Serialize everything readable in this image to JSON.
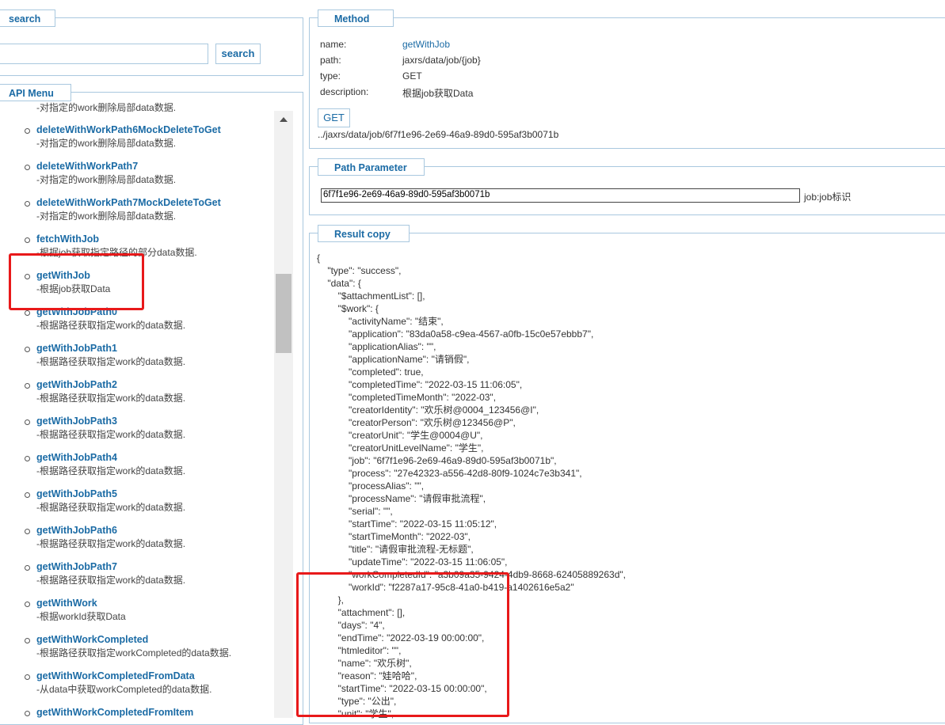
{
  "search": {
    "legend": "search",
    "input_value": "",
    "button_label": "search"
  },
  "menu": {
    "legend": "API Menu",
    "partial_top_text": "-对指定的work删除局部data数据.",
    "items": [
      {
        "name": "deleteWithWorkPath6MockDeleteToGet",
        "desc": "-对指定的work删除局部data数据."
      },
      {
        "name": "deleteWithWorkPath7",
        "desc": "-对指定的work删除局部data数据."
      },
      {
        "name": "deleteWithWorkPath7MockDeleteToGet",
        "desc": "-对指定的work删除局部data数据."
      },
      {
        "name": "fetchWithJob",
        "desc": "-根据job获取指定路径的部分data数据."
      },
      {
        "name": "getWithJob",
        "desc": "-根据job获取Data"
      },
      {
        "name": "getWithJobPath0",
        "desc": "-根据路径获取指定work的data数据."
      },
      {
        "name": "getWithJobPath1",
        "desc": "-根据路径获取指定work的data数据."
      },
      {
        "name": "getWithJobPath2",
        "desc": "-根据路径获取指定work的data数据."
      },
      {
        "name": "getWithJobPath3",
        "desc": "-根据路径获取指定work的data数据."
      },
      {
        "name": "getWithJobPath4",
        "desc": "-根据路径获取指定work的data数据."
      },
      {
        "name": "getWithJobPath5",
        "desc": "-根据路径获取指定work的data数据."
      },
      {
        "name": "getWithJobPath6",
        "desc": "-根据路径获取指定work的data数据."
      },
      {
        "name": "getWithJobPath7",
        "desc": "-根据路径获取指定work的data数据."
      },
      {
        "name": "getWithWork",
        "desc": "-根据workId获取Data"
      },
      {
        "name": "getWithWorkCompleted",
        "desc": "-根据路径获取指定workCompleted的data数据."
      },
      {
        "name": "getWithWorkCompletedFromData",
        "desc": "-从data中获取workCompleted的data数据."
      },
      {
        "name": "getWithWorkCompletedFromItem",
        "desc": ""
      }
    ]
  },
  "method": {
    "legend": "Method",
    "name_label": "name:",
    "name_value": "getWithJob",
    "path_label": "path:",
    "path_value": "jaxrs/data/job/{job}",
    "type_label": "type:",
    "type_value": "GET",
    "description_label": "description:",
    "description_value": "根据job获取Data",
    "get_button": "GET",
    "request_url": "../jaxrs/data/job/6f7f1e96-2e69-46a9-89d0-595af3b0071b"
  },
  "path_parameter": {
    "legend": "Path Parameter",
    "job_value": "6f7f1e96-2e69-46a9-89d0-595af3b0071b",
    "job_label": "job:job标识"
  },
  "result": {
    "legend": "Result copy",
    "json_text": "{\n    \"type\": \"success\",\n    \"data\": {\n        \"$attachmentList\": [],\n        \"$work\": {\n            \"activityName\": \"结束\",\n            \"application\": \"83da0a58-c9ea-4567-a0fb-15c0e57ebbb7\",\n            \"applicationAlias\": \"\",\n            \"applicationName\": \"请销假\",\n            \"completed\": true,\n            \"completedTime\": \"2022-03-15 11:06:05\",\n            \"completedTimeMonth\": \"2022-03\",\n            \"creatorIdentity\": \"欢乐树@0004_123456@I\",\n            \"creatorPerson\": \"欢乐树@123456@P\",\n            \"creatorUnit\": \"学生@0004@U\",\n            \"creatorUnitLevelName\": \"学生\",\n            \"job\": \"6f7f1e96-2e69-46a9-89d0-595af3b0071b\",\n            \"process\": \"27e42323-a556-42d8-80f9-1024c7e3b341\",\n            \"processAlias\": \"\",\n            \"processName\": \"请假审批流程\",\n            \"serial\": \"\",\n            \"startTime\": \"2022-03-15 11:05:12\",\n            \"startTimeMonth\": \"2022-03\",\n            \"title\": \"请假审批流程-无标题\",\n            \"updateTime\": \"2022-03-15 11:06:05\",\n            \"workCompletedId\": \"a3b09a35-9424-4db9-8668-62405889263d\",\n            \"workId\": \"f2287a17-95c8-41a0-b419-a1402616e5a2\"\n        },\n        \"attachment\": [],\n        \"days\": \"4\",\n        \"endTime\": \"2022-03-19 00:00:00\",\n        \"htmleditor\": \"\",\n        \"name\": \"欢乐树\",\n        \"reason\": \"娃哈哈\",\n        \"startTime\": \"2022-03-15 00:00:00\",\n        \"type\": \"公出\",\n        \"unit\": \"学生\","
  },
  "colors": {
    "accent": "#1b6ba5",
    "border": "#a9c8df",
    "highlight": "#e8191a"
  }
}
